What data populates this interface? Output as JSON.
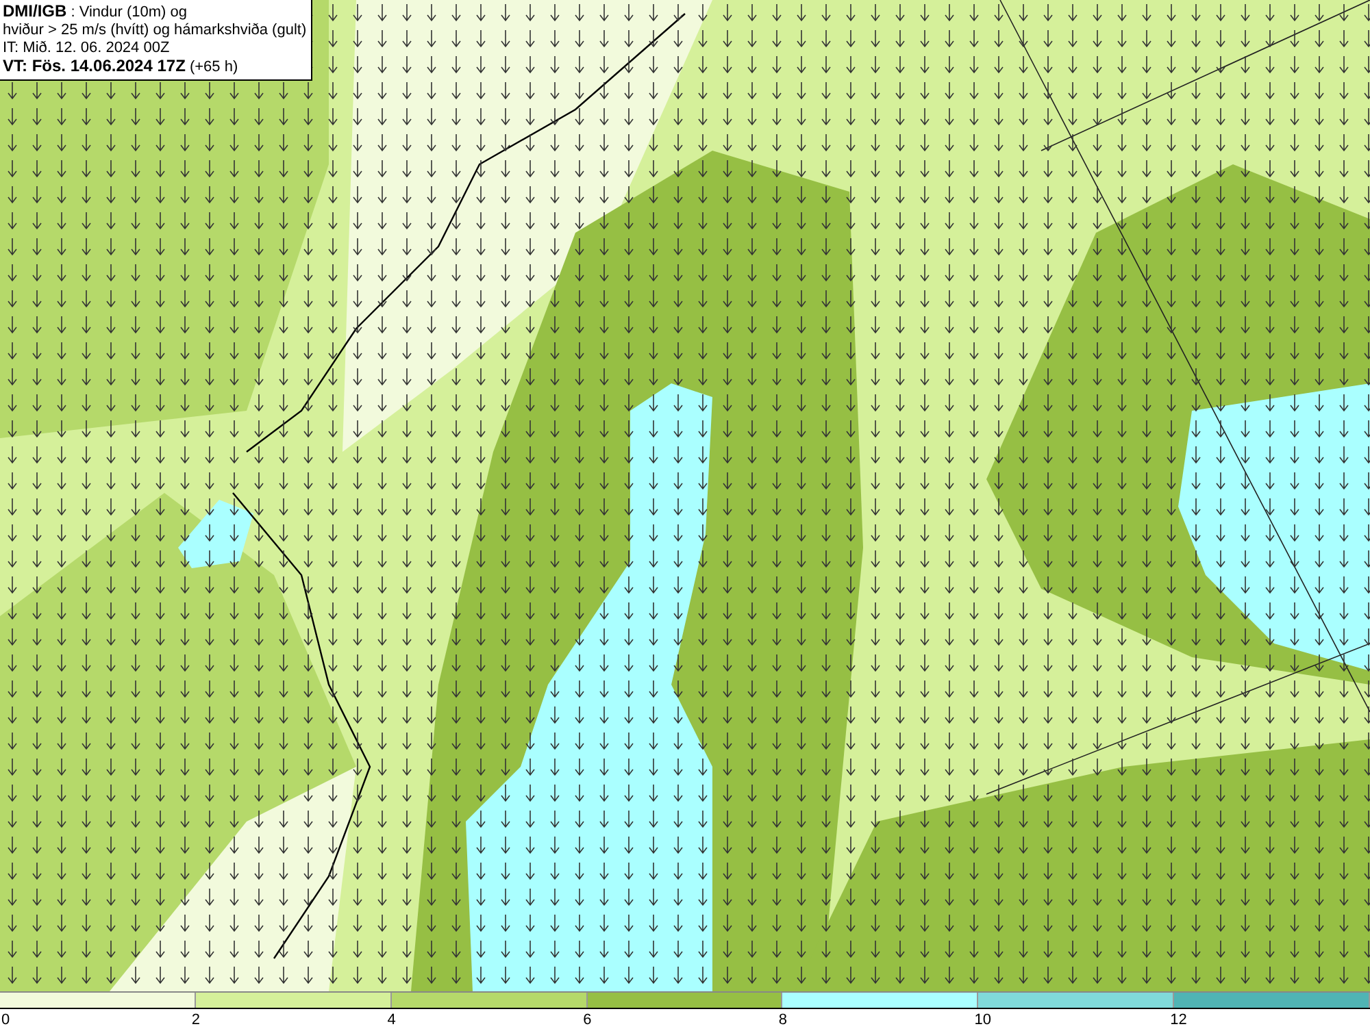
{
  "header": {
    "lines": [
      "**DMI/IGB** : Vindur (10m) og",
      "hviður > 25 m/s (hvítt) og hámarkshviða (gult)",
      "IT: Mið. 12. 06. 2024 00Z",
      "**VT: Fös. 14.06.2024 17Z** (+65 h)"
    ]
  },
  "colorbar": {
    "segments": [
      {
        "label": "0",
        "color": "#f2fadc"
      },
      {
        "label": "2",
        "color": "#d5f09a"
      },
      {
        "label": "4",
        "color": "#b5d96a"
      },
      {
        "label": "6",
        "color": "#96bf44"
      },
      {
        "label": "8",
        "color": "#aaffff"
      },
      {
        "label": "10",
        "color": "#80dada"
      },
      {
        "label": "12",
        "color": "#50b4b4"
      }
    ]
  }
}
